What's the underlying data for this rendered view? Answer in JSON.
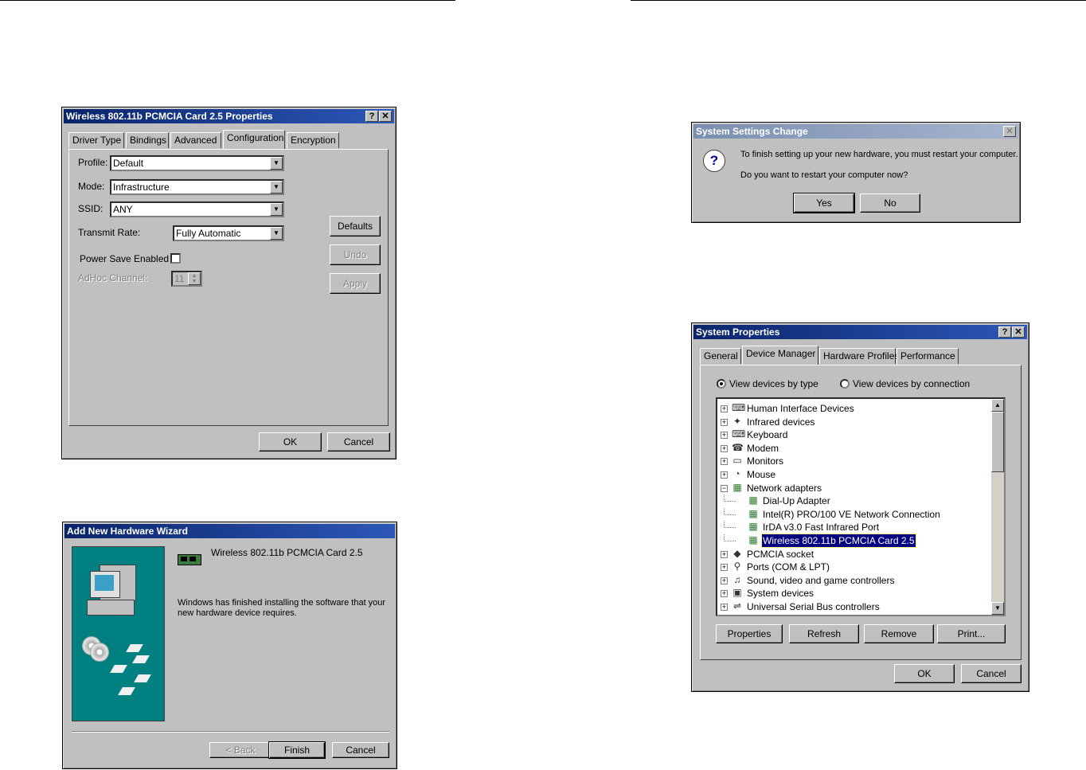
{
  "props": {
    "title": "Wireless 802.11b PCMCIA Card 2.5 Properties",
    "help": "?",
    "close": "✕",
    "tabs": [
      "Driver Type",
      "Bindings",
      "Advanced",
      "Configuration",
      "Encryption"
    ],
    "active_tab": "Configuration",
    "profile_label": "Profile:",
    "profile_value": "Default",
    "mode_label": "Mode:",
    "mode_value": "Infrastructure",
    "ssid_label": "SSID:",
    "ssid_value": "ANY",
    "rate_label": "Transmit Rate:",
    "rate_value": "Fully Automatic",
    "power_label": "Power Save Enabled",
    "adhoc_label": "AdHoc Channel:",
    "adhoc_value": "11",
    "defaults": "Defaults",
    "undo": "Undo",
    "apply": "Apply",
    "ok": "OK",
    "cancel": "Cancel"
  },
  "wizard": {
    "title": "Add New Hardware Wizard",
    "device": "Wireless 802.11b PCMCIA Card 2.5",
    "message": "Windows has finished installing the software that your new hardware device requires.",
    "back": "< Back",
    "finish": "Finish",
    "cancel": "Cancel"
  },
  "restart": {
    "title": "System Settings Change",
    "close": "✕",
    "line1": "To finish setting up your new hardware, you must restart your computer.",
    "line2": "Do you want to restart your computer now?",
    "yes": "Yes",
    "no": "No"
  },
  "sysprops": {
    "title": "System Properties",
    "help": "?",
    "close": "✕",
    "tabs": [
      "General",
      "Device Manager",
      "Hardware Profiles",
      "Performance"
    ],
    "active_tab": "Device Manager",
    "radio_type": "View devices by type",
    "radio_conn": "View devices by connection",
    "tree": [
      {
        "label": "Human Interface Devices",
        "pm": "+",
        "icon": "hid-icon",
        "glyph": "⌨"
      },
      {
        "label": "Infrared devices",
        "pm": "+",
        "icon": "infrared-icon",
        "glyph": "✦"
      },
      {
        "label": "Keyboard",
        "pm": "+",
        "icon": "keyboard-icon",
        "glyph": "⌨"
      },
      {
        "label": "Modem",
        "pm": "+",
        "icon": "modem-icon",
        "glyph": "☎"
      },
      {
        "label": "Monitors",
        "pm": "+",
        "icon": "monitor-icon",
        "glyph": "▭"
      },
      {
        "label": "Mouse",
        "pm": "+",
        "icon": "mouse-icon",
        "glyph": "◔"
      },
      {
        "label": "Network adapters",
        "pm": "−",
        "icon": "network-adapter-icon",
        "glyph": "▦"
      },
      {
        "label": "Dial-Up Adapter",
        "child": true,
        "icon": "network-card-icon",
        "glyph": "▦"
      },
      {
        "label": "Intel(R) PRO/100 VE Network Connection",
        "child": true,
        "icon": "network-card-icon",
        "glyph": "▦"
      },
      {
        "label": "IrDA v3.0 Fast Infrared Port",
        "child": true,
        "icon": "network-card-icon",
        "glyph": "▦"
      },
      {
        "label": "Wireless 802.11b PCMCIA Card 2.5",
        "child": true,
        "selected": true,
        "icon": "network-card-icon",
        "glyph": "▦"
      },
      {
        "label": "PCMCIA socket",
        "pm": "+",
        "icon": "pcmcia-icon",
        "glyph": "◆"
      },
      {
        "label": "Ports (COM & LPT)",
        "pm": "+",
        "icon": "port-icon",
        "glyph": "⚲"
      },
      {
        "label": "Sound, video and game controllers",
        "pm": "+",
        "icon": "sound-icon",
        "glyph": "♫"
      },
      {
        "label": "System devices",
        "pm": "+",
        "icon": "system-icon",
        "glyph": "▣"
      },
      {
        "label": "Universal Serial Bus controllers",
        "pm": "+",
        "icon": "usb-icon",
        "glyph": "⇌"
      }
    ],
    "properties": "Properties",
    "refresh": "Refresh",
    "remove": "Remove",
    "print": "Print...",
    "ok": "OK",
    "cancel": "Cancel"
  }
}
